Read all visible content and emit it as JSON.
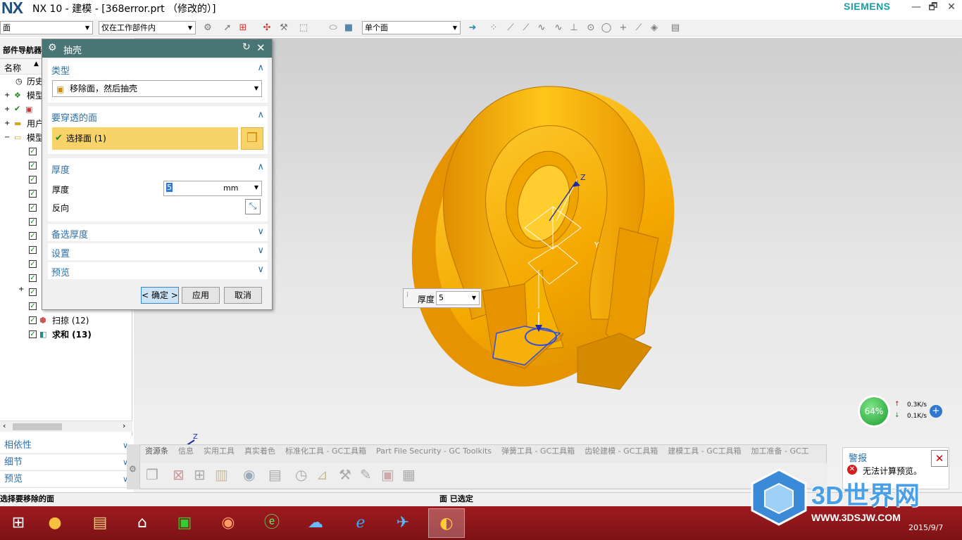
{
  "window": {
    "logo": "NX",
    "title": "NX 10 - 建模 - [368error.prt （修改的）]",
    "brand": "SIEMENS",
    "ctl_min": "—",
    "ctl_restore": "🗗",
    "ctl_close": "✕"
  },
  "toolbar": {
    "filter": "面",
    "scope": "仅在工作部件内",
    "face_rule": "单个面"
  },
  "navigator": {
    "header": "部件导航器",
    "col_name": "名称",
    "rows": [
      "历史",
      "模型",
      "",
      "用户",
      "模型"
    ],
    "features": [
      {
        "label": "扫掠 (12)"
      },
      {
        "label": "求和 (13)"
      }
    ]
  },
  "lower_panel": {
    "items": [
      "相依性",
      "细节",
      "预览"
    ]
  },
  "dialog": {
    "title": "抽壳",
    "type": {
      "header": "类型",
      "value": "移除面，然后抽壳"
    },
    "faces": {
      "header": "要穿透的面",
      "select_label": "选择面 (1)"
    },
    "thickness": {
      "header": "厚度",
      "label": "厚度",
      "value": "5",
      "unit": "mm",
      "reverse": "反向"
    },
    "alt_thickness": {
      "header": "备选厚度"
    },
    "settings": {
      "header": "设置"
    },
    "preview": {
      "header": "预览"
    },
    "buttons": {
      "ok": "< 确定 >",
      "apply": "应用",
      "cancel": "取消"
    }
  },
  "float_input": {
    "label": "厚度",
    "value": "5"
  },
  "triad": {
    "z": "Z",
    "y": "Y"
  },
  "resource_tabs": [
    "资源条",
    "信息",
    "实用工具",
    "真实着色",
    "标准化工具 - GC工具箱",
    "Part File Security - GC Toolkits",
    "弹簧工具 - GC工具箱",
    "齿轮建模 - GC工具箱",
    "建模工具 - GC工具箱",
    "加工准备 - GC工"
  ],
  "alert": {
    "title": "警报",
    "message": "无法计算预览。"
  },
  "network": {
    "percent": "64%",
    "up": "0.3K/s",
    "down": "0.1K/s"
  },
  "status": {
    "left": "选择要移除的面",
    "center": "面 已选定"
  },
  "watermark": {
    "brand": "3D世界网",
    "url": "WWW.3DSJW.COM"
  },
  "clock": {
    "date": "2015/9/7"
  },
  "colors": {
    "accent": "#2a6fa8",
    "dialog_title": "#4a7575",
    "model": "#f5a800",
    "selected": "#f8d36a",
    "taskbar": "#8e171b"
  }
}
